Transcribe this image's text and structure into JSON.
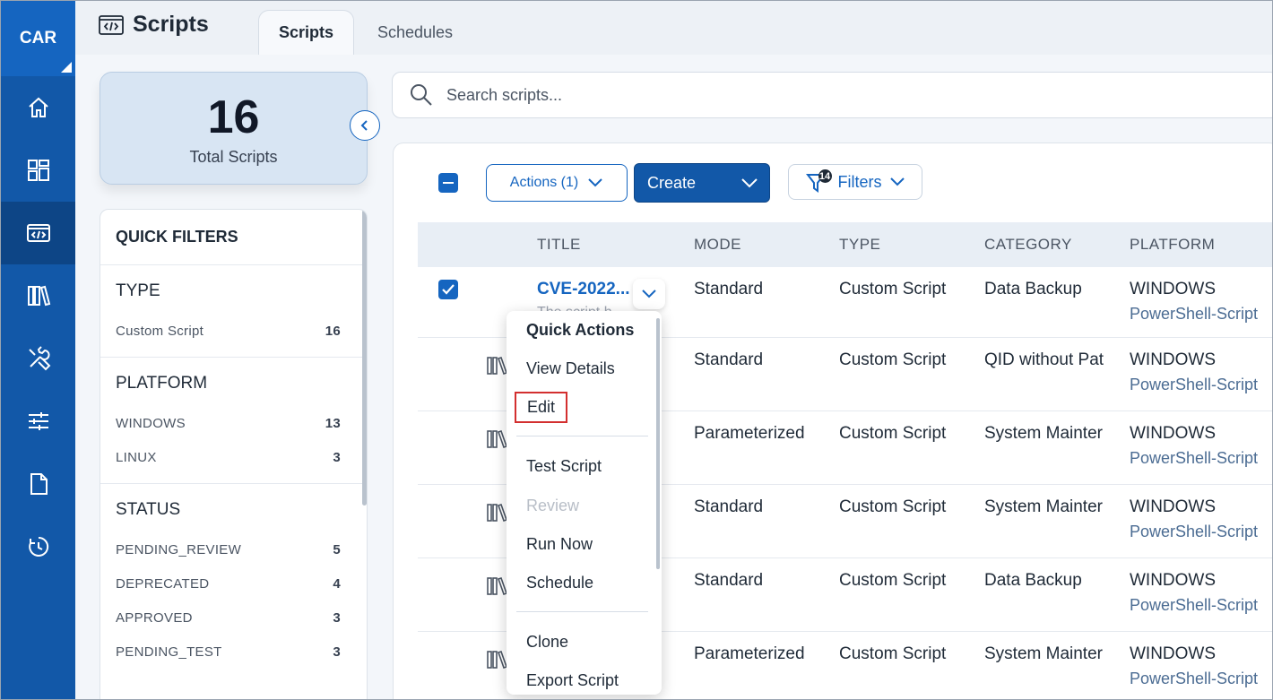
{
  "nav": {
    "brand": "CAR",
    "items": [
      {
        "icon": "home-icon"
      },
      {
        "icon": "dashboard-icon"
      },
      {
        "icon": "scripts-icon",
        "active": true
      },
      {
        "icon": "library-icon"
      },
      {
        "icon": "tools-icon"
      },
      {
        "icon": "sliders-icon"
      },
      {
        "icon": "document-icon"
      },
      {
        "icon": "history-icon"
      }
    ]
  },
  "header": {
    "title": "Scripts",
    "tabs": [
      {
        "label": "Scripts",
        "active": true
      },
      {
        "label": "Schedules",
        "active": false
      }
    ]
  },
  "summary": {
    "count": "16",
    "label": "Total Scripts"
  },
  "quick_filters": {
    "title": "QUICK FILTERS",
    "type": {
      "heading": "TYPE",
      "items": [
        {
          "label": "Custom Script",
          "count": "16"
        }
      ]
    },
    "platform": {
      "heading": "PLATFORM",
      "items": [
        {
          "label": "WINDOWS",
          "count": "13"
        },
        {
          "label": "LINUX",
          "count": "3"
        }
      ]
    },
    "status": {
      "heading": "STATUS",
      "items": [
        {
          "label": "PENDING_REVIEW",
          "count": "5"
        },
        {
          "label": "DEPRECATED",
          "count": "4"
        },
        {
          "label": "APPROVED",
          "count": "3"
        },
        {
          "label": "PENDING_TEST",
          "count": "3"
        }
      ]
    }
  },
  "search": {
    "placeholder": "Search scripts..."
  },
  "toolbar": {
    "actions_label": "Actions (1)",
    "create_label": "Create",
    "filters_label": "Filters",
    "filters_badge": "14"
  },
  "table": {
    "columns": [
      "TITLE",
      "MODE",
      "TYPE",
      "CATEGORY",
      "PLATFORM"
    ],
    "rows": [
      {
        "title": "CVE-2022...",
        "subtitle": "The script h...",
        "mode": "Standard",
        "type": "Custom Script",
        "category": "Data Backup",
        "platform": "WINDOWS",
        "platform_sub": "PowerShell-Script"
      },
      {
        "title": "",
        "subtitle": "",
        "mode": "Standard",
        "type": "Custom Script",
        "category": "QID without Pat",
        "platform": "WINDOWS",
        "platform_sub": "PowerShell-Script"
      },
      {
        "title": "",
        "subtitle": "",
        "mode": "Parameterized",
        "type": "Custom Script",
        "category": "System Mainter",
        "platform": "WINDOWS",
        "platform_sub": "PowerShell-Script"
      },
      {
        "title": "",
        "subtitle": "",
        "mode": "Standard",
        "type": "Custom Script",
        "category": "System Mainter",
        "platform": "WINDOWS",
        "platform_sub": "PowerShell-Script"
      },
      {
        "title": "",
        "subtitle": "",
        "mode": "Standard",
        "type": "Custom Script",
        "category": "Data Backup",
        "platform": "WINDOWS",
        "platform_sub": "PowerShell-Script"
      },
      {
        "title": "",
        "subtitle": "",
        "mode": "Parameterized",
        "type": "Custom Script",
        "category": "System Mainter",
        "platform": "WINDOWS",
        "platform_sub": "PowerShell-Script"
      }
    ]
  },
  "menu": {
    "heading": "Quick Actions",
    "items": [
      "View Details",
      "Edit",
      "Test Script",
      "Review",
      "Run Now",
      "Schedule",
      "Clone",
      "Export Script"
    ]
  },
  "colors": {
    "primary": "#1565c0",
    "nav": "#1258a8",
    "highlight": "#d32f2f"
  }
}
